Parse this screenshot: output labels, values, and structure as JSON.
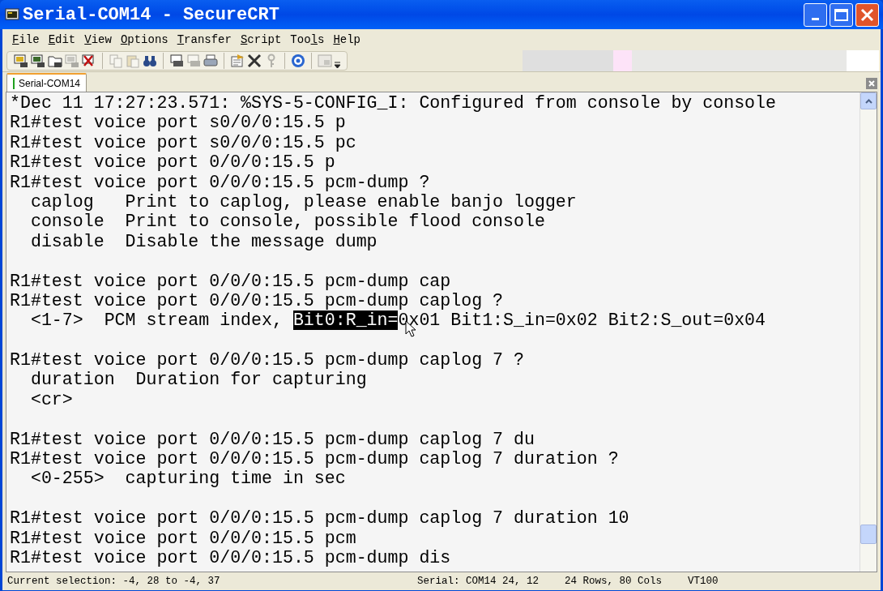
{
  "window": {
    "title": "Serial-COM14 - SecureCRT"
  },
  "menu": [
    {
      "accel": "F",
      "after": "ile"
    },
    {
      "accel": "E",
      "after": "dit"
    },
    {
      "accel": "V",
      "after": "iew"
    },
    {
      "accel": "O",
      "after": "ptions"
    },
    {
      "accel": "T",
      "after": "ransfer"
    },
    {
      "accel": "S",
      "after": "cript"
    },
    {
      "before": "Too",
      "accel": "l",
      "after": "s"
    },
    {
      "accel": "H",
      "after": "elp"
    }
  ],
  "tabs": [
    {
      "label": "Serial-COM14",
      "selected": true
    }
  ],
  "terminal": {
    "lines": [
      {
        "kind": "text",
        "segments": [
          {
            "text": "*Dec 11 17:27:23.571: %SYS-5-CONFIG_I: Configured from console by console",
            "selected": false
          }
        ]
      },
      {
        "kind": "text",
        "segments": [
          {
            "text": "R1#test voice port s0/0/0:15.5 p",
            "selected": false
          }
        ]
      },
      {
        "kind": "text",
        "segments": [
          {
            "text": "R1#test voice port s0/0/0:15.5 pc",
            "selected": false
          }
        ]
      },
      {
        "kind": "text",
        "segments": [
          {
            "text": "R1#test voice port 0/0/0:15.5 p",
            "selected": false
          }
        ]
      },
      {
        "kind": "text",
        "segments": [
          {
            "text": "R1#test voice port 0/0/0:15.5 pcm-dump ?",
            "selected": false
          }
        ]
      },
      {
        "kind": "text",
        "segments": [
          {
            "text": "  caplog   Print to caplog, please enable banjo logger",
            "selected": false
          }
        ]
      },
      {
        "kind": "text",
        "segments": [
          {
            "text": "  console  Print to console, possible flood console",
            "selected": false
          }
        ]
      },
      {
        "kind": "text",
        "segments": [
          {
            "text": "  disable  Disable the message dump",
            "selected": false
          }
        ]
      },
      {
        "kind": "blank"
      },
      {
        "kind": "text",
        "segments": [
          {
            "text": "R1#test voice port 0/0/0:15.5 pcm-dump cap",
            "selected": false
          }
        ]
      },
      {
        "kind": "text",
        "segments": [
          {
            "text": "R1#test voice port 0/0/0:15.5 pcm-dump caplog ?",
            "selected": false
          }
        ]
      },
      {
        "kind": "text",
        "segments": [
          {
            "text": "  <1-7>  PCM stream index, ",
            "selected": false
          },
          {
            "text": "Bit0:R_in=",
            "selected": true
          },
          {
            "text": "0x01 Bit1:S_in=0x02 Bit2:S_out=0x04",
            "selected": false
          }
        ]
      },
      {
        "kind": "blank"
      },
      {
        "kind": "text",
        "segments": [
          {
            "text": "R1#test voice port 0/0/0:15.5 pcm-dump caplog 7 ?",
            "selected": false
          }
        ]
      },
      {
        "kind": "text",
        "segments": [
          {
            "text": "  duration  Duration for capturing",
            "selected": false
          }
        ]
      },
      {
        "kind": "text",
        "segments": [
          {
            "text": "  <cr>",
            "selected": false
          }
        ]
      },
      {
        "kind": "blank"
      },
      {
        "kind": "text",
        "segments": [
          {
            "text": "R1#test voice port 0/0/0:15.5 pcm-dump caplog 7 du",
            "selected": false
          }
        ]
      },
      {
        "kind": "text",
        "segments": [
          {
            "text": "R1#test voice port 0/0/0:15.5 pcm-dump caplog 7 duration ?",
            "selected": false
          }
        ]
      },
      {
        "kind": "text",
        "segments": [
          {
            "text": "  <0-255>  capturing time in sec",
            "selected": false
          }
        ]
      },
      {
        "kind": "blank"
      },
      {
        "kind": "text",
        "segments": [
          {
            "text": "R1#test voice port 0/0/0:15.5 pcm-dump caplog 7 duration 10",
            "selected": false
          }
        ]
      },
      {
        "kind": "text",
        "segments": [
          {
            "text": "R1#test voice port 0/0/0:15.5 pcm",
            "selected": false
          }
        ]
      },
      {
        "kind": "text",
        "segments": [
          {
            "text": "R1#test voice port 0/0/0:15.5 pcm-dump dis",
            "selected": false
          }
        ]
      }
    ]
  },
  "status_bar": {
    "selection": "Current selection: -4, 28 to -4, 37",
    "connection": "Serial: COM14",
    "cursor": "24,  12",
    "size": "24 Rows,  80 Cols",
    "emulation": "VT100"
  }
}
